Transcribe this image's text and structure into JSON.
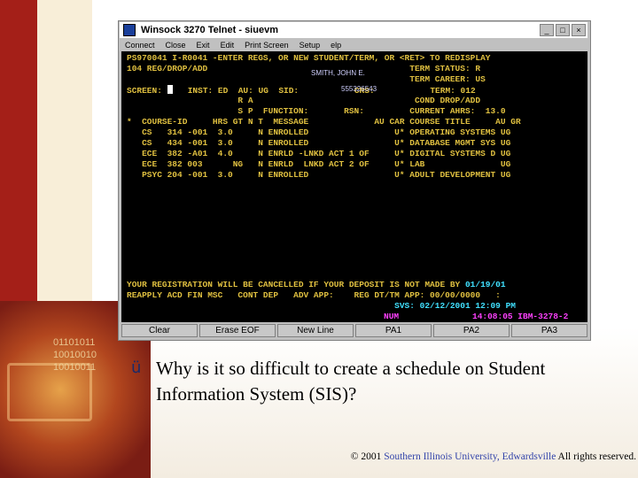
{
  "window": {
    "title": "Winsock 3270 Telnet - siuevm",
    "buttons": [
      "_",
      "□",
      "×"
    ],
    "menu": [
      "Connect",
      "Close",
      "Exit",
      "Edit",
      "Print Screen",
      "Setup",
      "elp"
    ]
  },
  "screen": {
    "line1": "PS970041 I-R0041 -ENTER REGS, OR NEW STUDENT/TERM, OR <RET> TO REDISPLAY",
    "line2": "104 REG/DROP/ADD                                        TERM STATUS: R",
    "name_overlay": "SMITH, JOHN E.",
    "line3": "                                                        TERM CAREER: US",
    "line4_a": "SCREEN: ",
    "line4_b": "   INST: ED  AU: UG  SID:           CRS:           TERM: 012",
    "sid_overlay": "555326543",
    "line5": "                      R A                                COND DROP/ADD",
    "line6": "                      S P  FUNCTION:       RSN:         CURRENT AHRS:  13.0",
    "line7": "*  COURSE-ID     HRS GT N T  MESSAGE             AU CAR COURSE TITLE     AU GR",
    "rows": [
      "   CS   314 -001  3.0     N ENROLLED                 U* OPERATING SYSTEMS UG",
      "   CS   434 -001  3.0     N ENROLLED                 U* DATABASE MGMT SYS UG",
      "   ECE  382 -A01  4.0     N ENRLD -LNKD ACT 1 OF     U* DIGITAL SYSTEMS D UG",
      "   ECE  382 003      NG   N ENRLD  LNKD ACT 2 OF     U* LAB               UG",
      "   PSYC 204 -001  3.0     N ENROLLED                 U* ADULT DEVELOPMENT UG"
    ],
    "msg_line1": "YOUR REGISTRATION WILL BE CANCELLED IF YOUR DEPOSIT IS NOT MADE BY",
    "deposit_date": "01/19/01",
    "msg_line2": "REAPPLY ACD FIN MSC   CONT DEP   ADV APP:    REG DT/TM APP: 00/00/0000   :",
    "msg_line3": "                                                     SVS: 02/12/2001 12:09 PM",
    "status_num": "NUM",
    "status_time": "14:08:05 IBM-3278-2"
  },
  "pf_keys": [
    "Clear",
    "Erase EOF",
    "New Line",
    "PA1",
    "PA2",
    "PA3"
  ],
  "slide": {
    "binary": [
      "01101011",
      "10010010",
      "10010011"
    ],
    "bullet": "ü",
    "question": "Why is it so difficult to create a schedule on Student Information System (SIS)?",
    "footer_prefix": "© 2001 ",
    "footer_link": "Southern Illinois University, Edwardsville",
    "footer_suffix": " All rights reserved."
  }
}
